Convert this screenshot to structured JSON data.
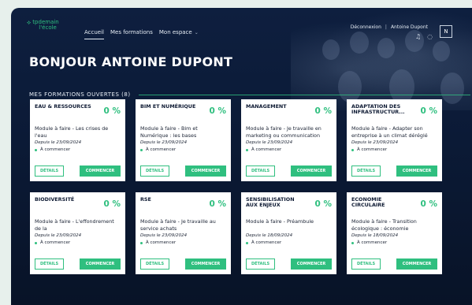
{
  "brand": {
    "mark": "⟡",
    "name_a": "tp",
    "name_b": "demain",
    "name_c": "l'école"
  },
  "nav": {
    "home": "Accueil",
    "courses": "Mes formations",
    "space": "Mon espace"
  },
  "account": {
    "logout": "Déconnexion",
    "user": "Antoine Dupont",
    "avatar_initial": "N"
  },
  "greeting": "BONJOUR ANTOINE DUPONT",
  "section_title": "MES FORMATIONS OUVERTES (8)",
  "labels": {
    "details": "DÉTAILS",
    "start": "COMMENCER",
    "status": "À commencer"
  },
  "colors": {
    "accent": "#2fbf7f",
    "background": "#0e1f3f"
  },
  "icons": {
    "notifications": "bell-icon",
    "help": "chat-icon"
  },
  "cards": [
    {
      "title": "EAU & RESSOURCES",
      "percent": "0 %",
      "desc": "Module à faire - Les crises de l'eau",
      "date": "Depuis le 23/09/2024"
    },
    {
      "title": "BIM ET NUMÉRIQUE",
      "percent": "0 %",
      "desc": "Module à faire - Bim et Numérique : les bases",
      "date": "Depuis le 23/09/2024"
    },
    {
      "title": "MANAGEMENT",
      "percent": "0 %",
      "desc": "Module à faire - Je travaille en marketing ou communication",
      "date": "Depuis le 23/09/2024"
    },
    {
      "title": "ADAPTATION DES INFRASTRUCTUR...",
      "percent": "0 %",
      "desc": "Module à faire - Adapter son entreprise à un climat déréglé",
      "date": "Depuis le 23/09/2024"
    },
    {
      "title": "BIODIVERSITÉ",
      "percent": "0 %",
      "desc": "Module à faire - L'effondrement de la",
      "date": "Depuis le 23/09/2024"
    },
    {
      "title": "RSE",
      "percent": "0 %",
      "desc": "Module à faire - Je travaille au service achats",
      "date": "Depuis le 23/09/2024"
    },
    {
      "title": "SENSIBILISATION AUX ENJEUX",
      "percent": "0 %",
      "desc": "Module à faire - Préambule",
      "date": "Depuis le 18/09/2024"
    },
    {
      "title": "ECONOMIE CIRCULAIRE",
      "percent": "0 %",
      "desc": "Module à faire - Transition écologique : économie",
      "date": "Depuis le 18/09/2024"
    }
  ]
}
